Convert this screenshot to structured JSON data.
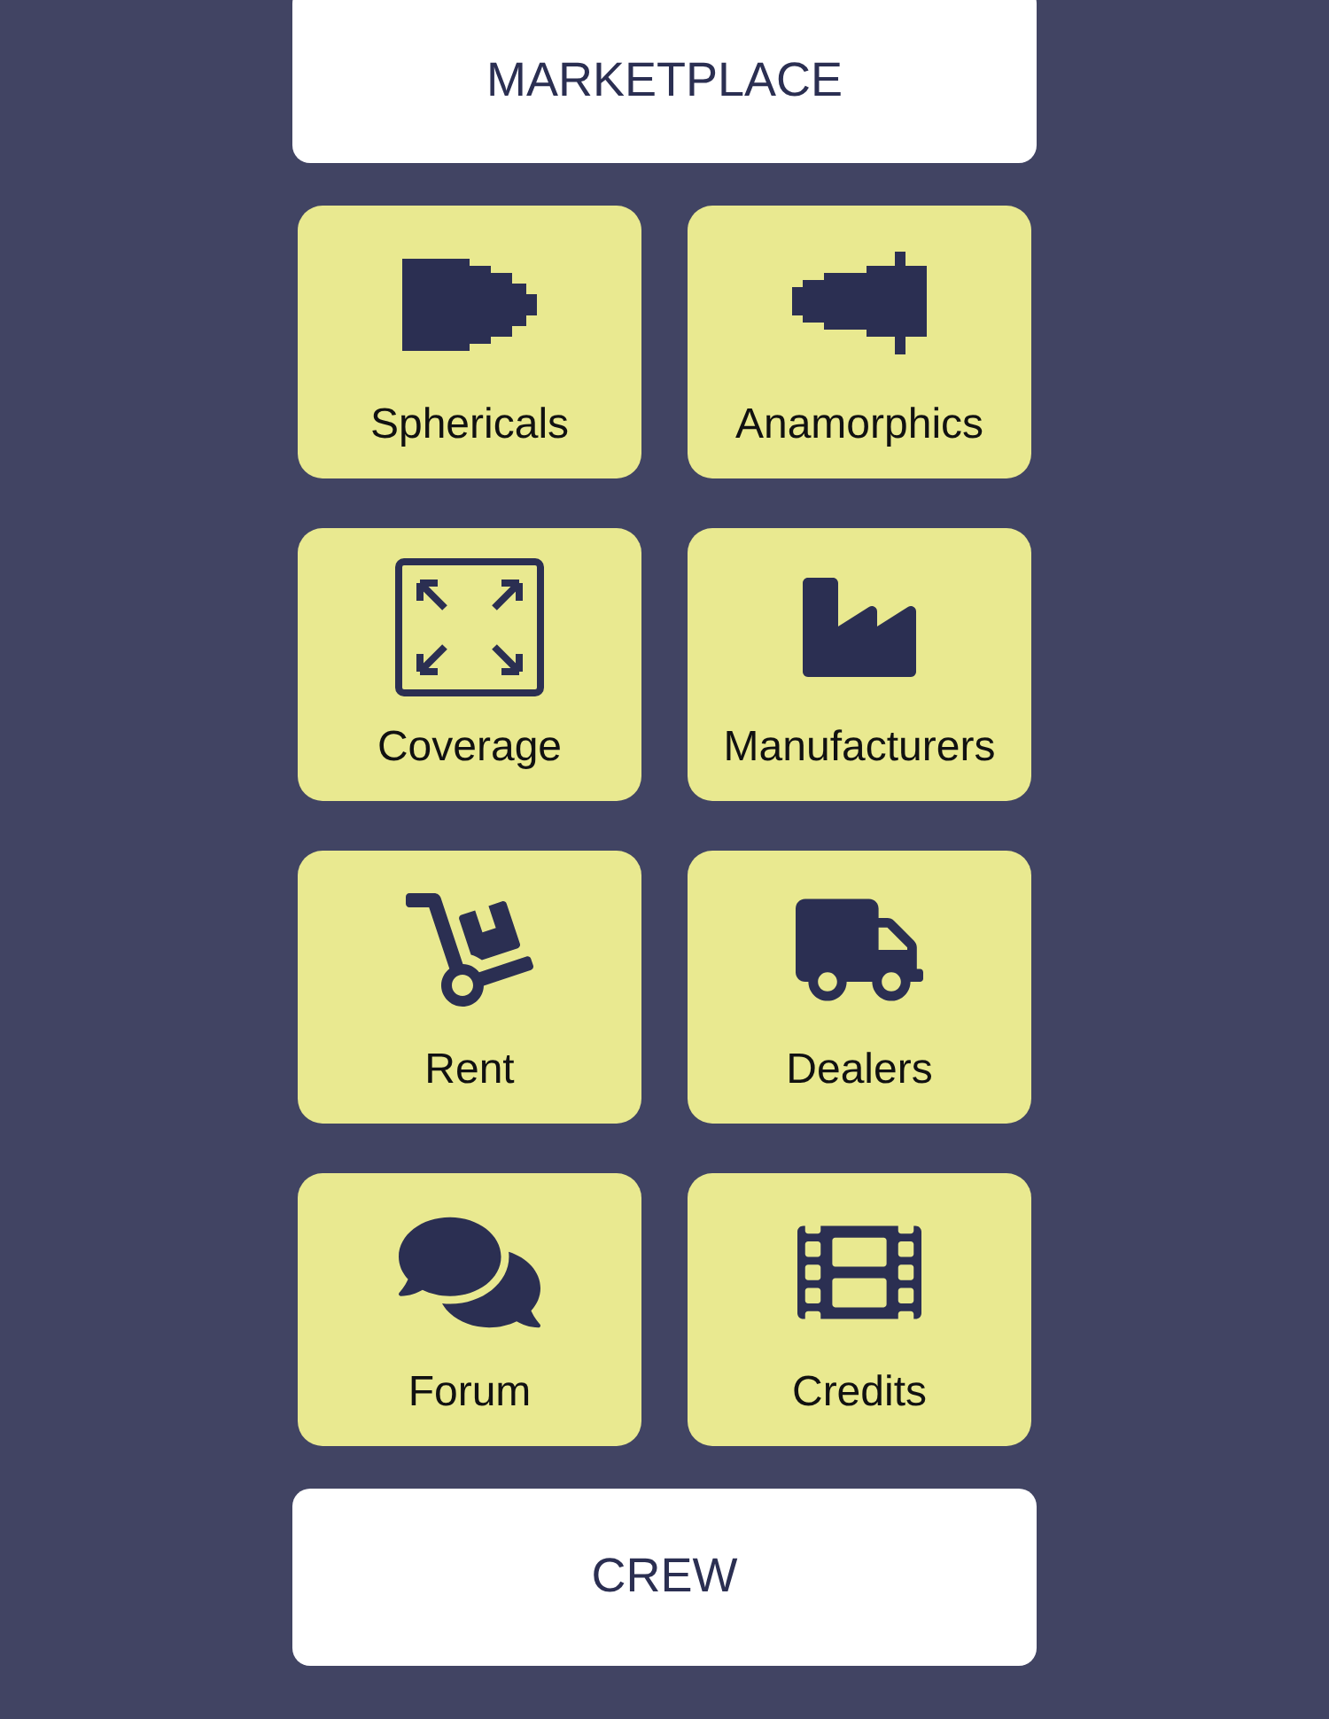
{
  "top_button": {
    "label": "MARKETPLACE"
  },
  "tiles": [
    {
      "label": "Sphericals"
    },
    {
      "label": "Anamorphics"
    },
    {
      "label": "Coverage"
    },
    {
      "label": "Manufacturers"
    },
    {
      "label": "Rent"
    },
    {
      "label": "Dealers"
    },
    {
      "label": "Forum"
    },
    {
      "label": "Credits"
    }
  ],
  "bottom_button": {
    "label": "CREW"
  }
}
